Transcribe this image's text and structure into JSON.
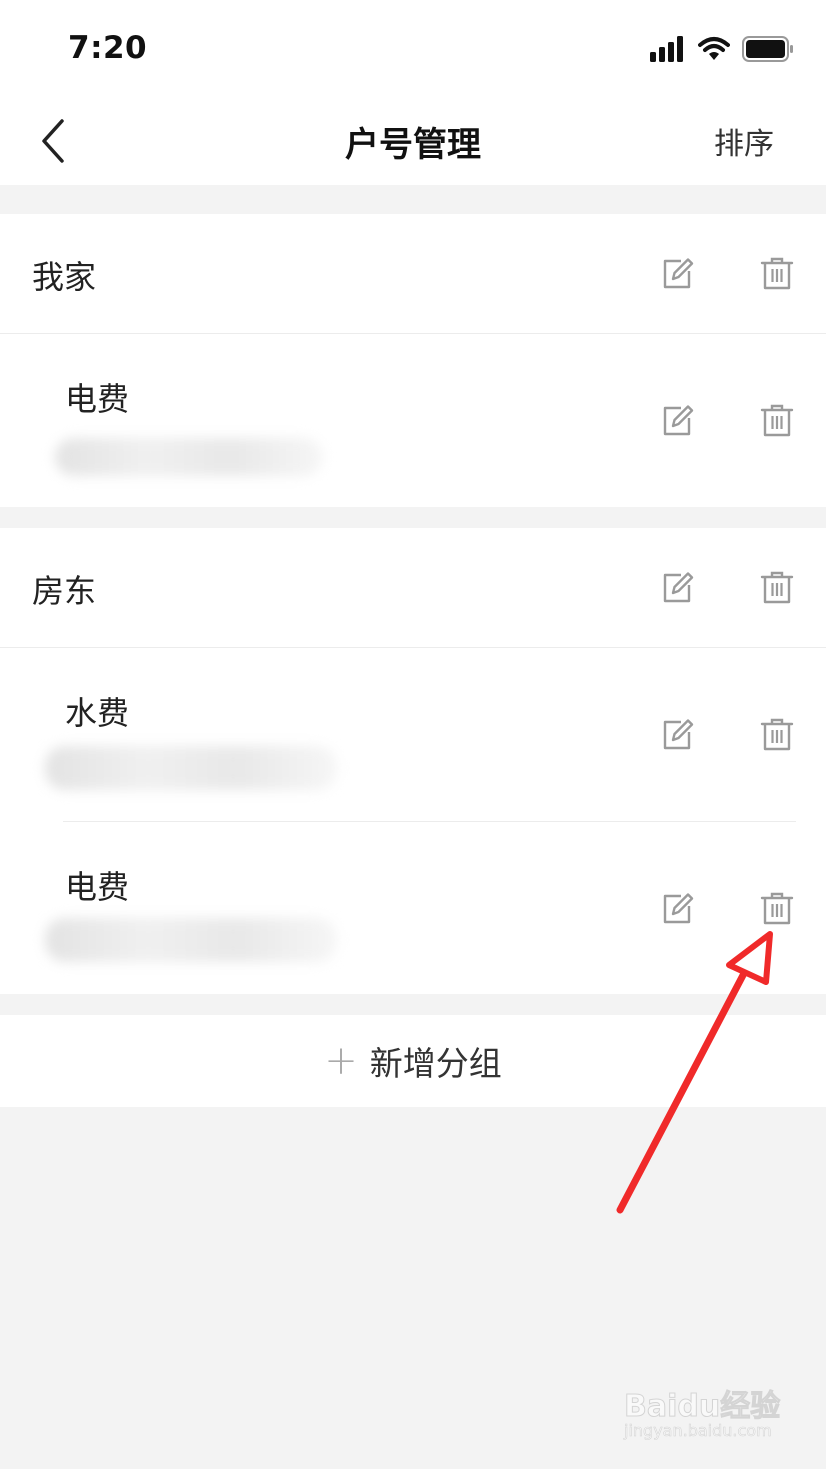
{
  "status_bar": {
    "time": "7:20"
  },
  "nav": {
    "title": "户号管理",
    "sort_label": "排序"
  },
  "groups": [
    {
      "name": "我家",
      "accounts": [
        {
          "name": "电费"
        }
      ]
    },
    {
      "name": "房东",
      "accounts": [
        {
          "name": "水费"
        },
        {
          "name": "电费"
        }
      ]
    }
  ],
  "add_group": {
    "label": "新增分组"
  },
  "watermark": {
    "logo": "Baidu经验",
    "url": "jingyan.baidu.com"
  },
  "colors": {
    "background": "#f3f3f3",
    "icon_gray": "#9a9a9a",
    "annotation_red": "#f02a2a"
  },
  "icons": [
    "back-chevron",
    "edit-icon",
    "trash-icon",
    "plus-icon",
    "signal-icon",
    "wifi-icon",
    "battery-icon"
  ]
}
